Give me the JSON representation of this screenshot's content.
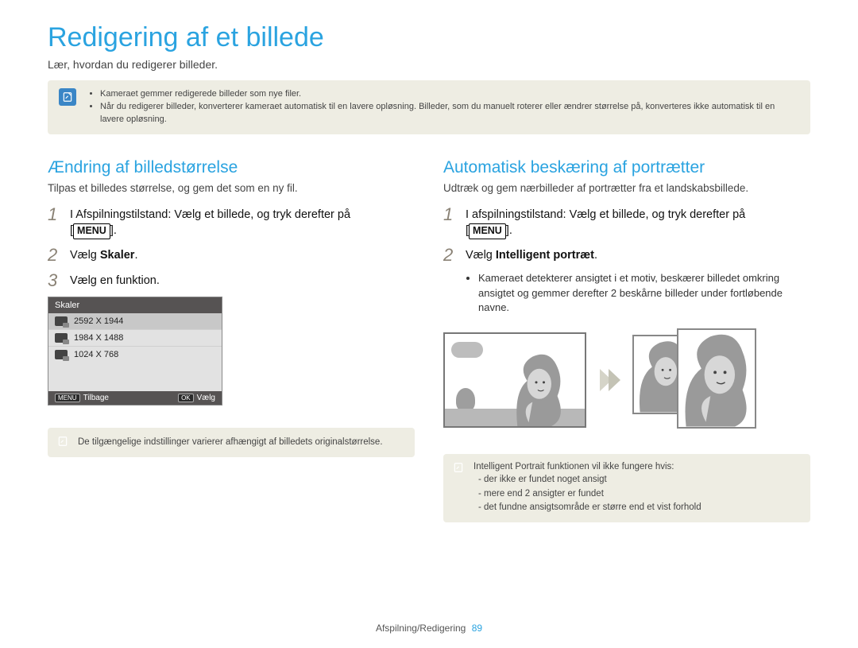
{
  "title": "Redigering af et billede",
  "subtitle": "Lær, hvordan du redigerer billeder.",
  "top_info": {
    "bullets": [
      "Kameraet gemmer redigerede billeder som nye filer.",
      "Når du redigerer billeder, konverterer kameraet automatisk til en lavere opløsning. Billeder, som du manuelt roterer eller ændrer størrelse på, konverteres ikke automatisk til en lavere opløsning."
    ]
  },
  "left": {
    "heading": "Ændring af billedstørrelse",
    "sub": "Tilpas et billedes størrelse, og gem det som en ny fil.",
    "steps": {
      "one_num": "1",
      "one_a": "I Afspilningstilstand: Vælg et billede, og tryk derefter på ",
      "one_b": ".",
      "menu_label": "MENU",
      "two_num": "2",
      "two_a": "Vælg ",
      "two_b": "Skaler",
      "two_c": ".",
      "three_num": "3",
      "three": "Vælg en funktion."
    },
    "panel": {
      "title": "Skaler",
      "rows": [
        "2592 X 1944",
        "1984 X 1488",
        "1024 X 768"
      ],
      "back_btn": "MENU",
      "back_label": "Tilbage",
      "ok_btn": "OK",
      "ok_label": "Vælg"
    },
    "note": "De tilgængelige indstillinger varierer afhængigt af billedets originalstørrelse."
  },
  "right": {
    "heading": "Automatisk beskæring af portrætter",
    "sub": "Udtræk og gem nærbilleder af portrætter fra et landskabsbillede.",
    "steps": {
      "one_num": "1",
      "one_a": "I afspilningstilstand: Vælg et billede, og tryk derefter på ",
      "one_b": ".",
      "menu_label": "MENU",
      "two_num": "2",
      "two_a": "Vælg ",
      "two_b": "Intelligent portræt",
      "two_c": "."
    },
    "bullet": "Kameraet detekterer ansigtet i et motiv, beskærer billedet omkring ansigtet og gemmer derefter 2 beskårne billeder under fortløbende navne.",
    "note_title": "Intelligent Portrait funktionen vil ikke fungere hvis:",
    "note_points": [
      "der ikke er fundet noget ansigt",
      "mere end 2 ansigter er fundet",
      "det fundne ansigtsområde er større end et vist forhold"
    ]
  },
  "footer": {
    "chapter": "Afspilning/Redigering",
    "page": "89"
  },
  "icons": {
    "note_icon": "note-icon"
  }
}
